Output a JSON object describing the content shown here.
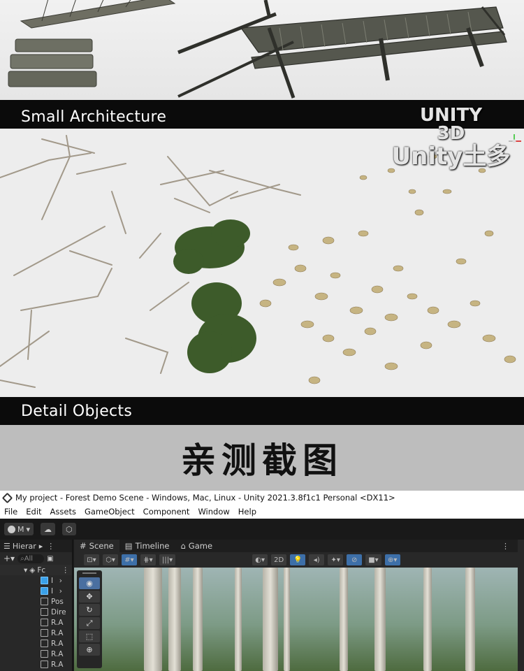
{
  "sections": {
    "small_architecture": "Small Architecture",
    "detail_objects": "Detail Objects"
  },
  "banner": "亲测截图",
  "window_title": "My project - Forest Demo Scene - Windows, Mac, Linux - Unity 2021.3.8f1c1 Personal <DX11>",
  "menu": [
    "File",
    "Edit",
    "Assets",
    "GameObject",
    "Component",
    "Window",
    "Help"
  ],
  "toolbar": {
    "account": "M",
    "cloud_icon": "cloud-icon",
    "collab_icon": "collab-icon"
  },
  "hierarchy": {
    "tab": "Hierar",
    "search_placeholder": "All",
    "scene_root": "Fc",
    "items": [
      "I",
      "I",
      "Pos",
      "Dire",
      "R.A",
      "R.A",
      "R.A",
      "R.A",
      "R.A"
    ]
  },
  "scene_tabs": [
    "Scene",
    "Timeline",
    "Game"
  ],
  "scene_toolbar": {
    "mode_2d": "2D"
  },
  "watermark": {
    "line1": "UNITY",
    "line2": "3D",
    "line3": "Unity土多"
  },
  "colors": {
    "accent": "#3d6fa8",
    "selected_cube": "#3aa0e8",
    "editor_bg": "#191919"
  }
}
